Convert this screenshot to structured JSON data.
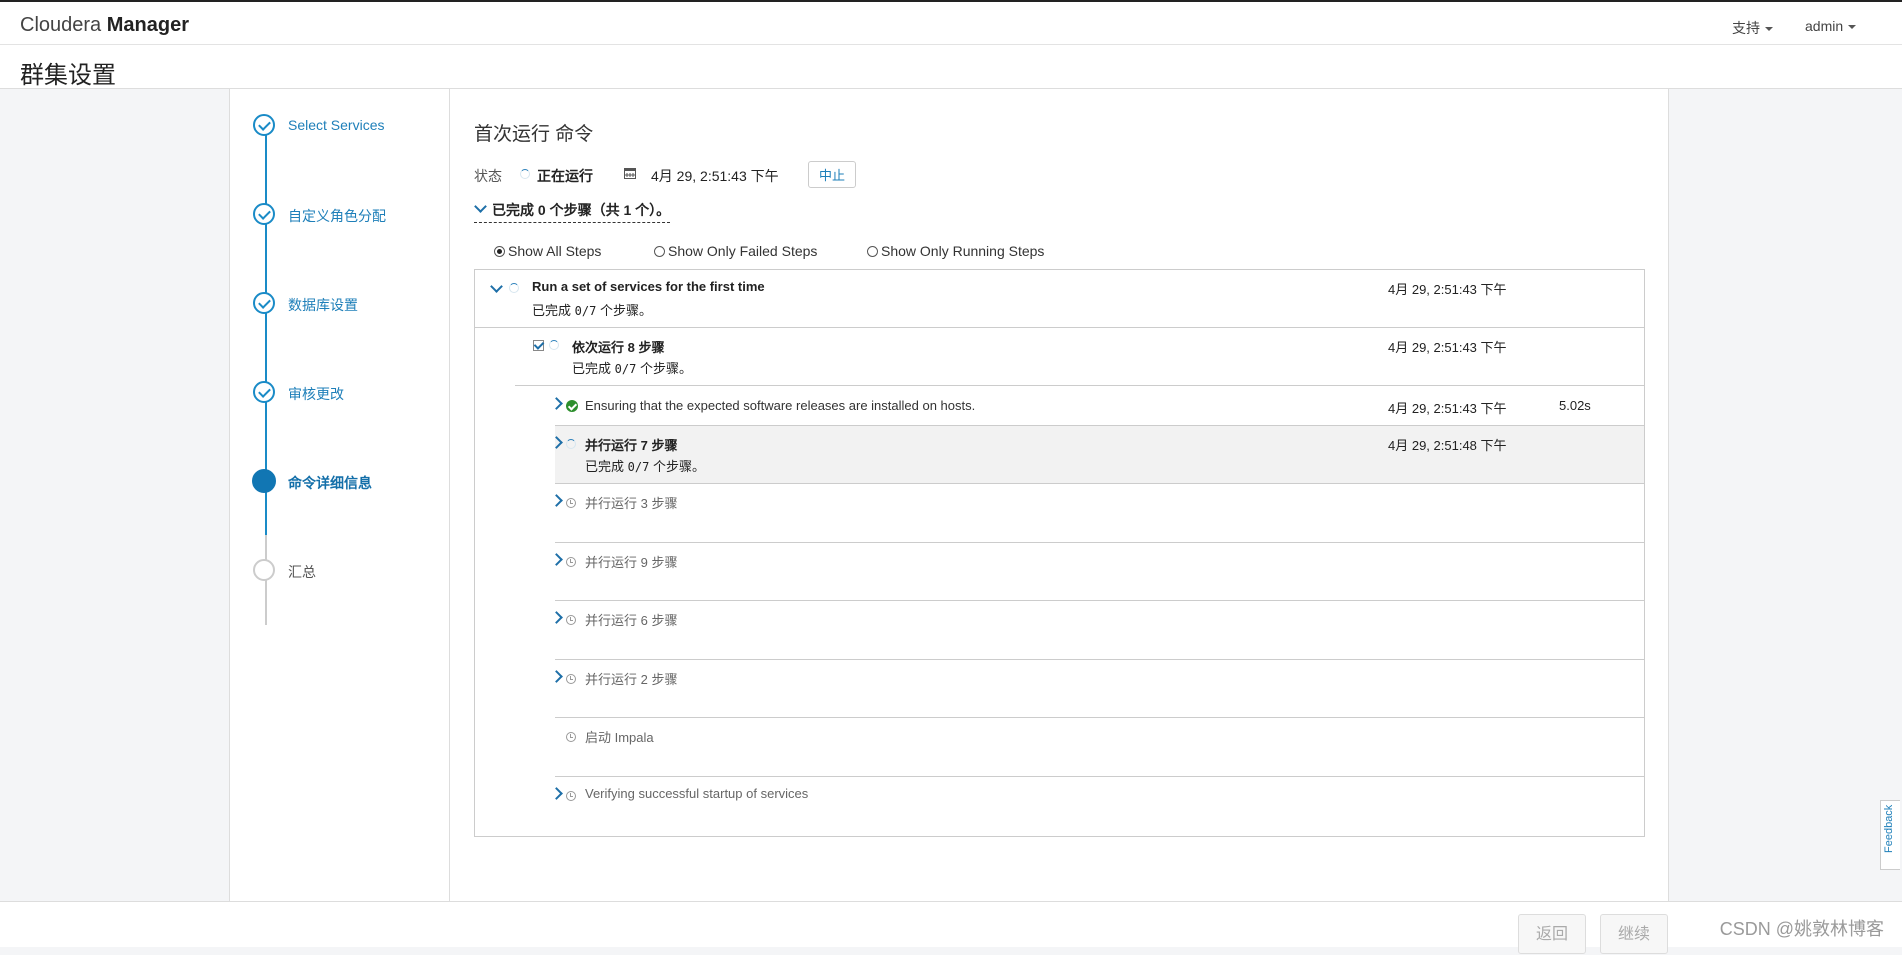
{
  "navbar": {
    "brand_light": "Cloudera",
    "brand_bold": "Manager",
    "support_label": "支持",
    "user_label": "admin"
  },
  "page_title": "群集设置",
  "wizard": {
    "steps": [
      {
        "label": "Select Services",
        "state": "done"
      },
      {
        "label": "自定义角色分配",
        "state": "done"
      },
      {
        "label": "数据库设置",
        "state": "done"
      },
      {
        "label": "审核更改",
        "state": "done"
      },
      {
        "label": "命令详细信息",
        "state": "active"
      },
      {
        "label": "汇总",
        "state": "pending"
      }
    ]
  },
  "command": {
    "title": "首次运行 命令",
    "status_label": "状态",
    "status_value": "正在运行",
    "status_time": "4月 29, 2:51:43 下午",
    "abort_label": "中止",
    "completed_summary": "已完成 0 个步骤（共 1 个）。"
  },
  "filters": [
    {
      "label": "Show All Steps",
      "selected": true
    },
    {
      "label": "Show Only Failed Steps",
      "selected": false
    },
    {
      "label": "Show Only Running Steps",
      "selected": false
    }
  ],
  "steps_table": {
    "root": {
      "title": "Run a set of services for the first time",
      "progress_prefix": "已完成",
      "progress": "0/7",
      "progress_suffix": "个步骤。",
      "time": "4月 29, 2:51:43 下午"
    },
    "sequence": {
      "title": "依次运行 8 步骤",
      "progress_prefix": "已完成",
      "progress": "0/7",
      "progress_suffix": "个步骤。",
      "time": "4月 29, 2:51:43 下午"
    },
    "children": [
      {
        "title": "Ensuring that the expected software releases are installed on hosts.",
        "time": "4月 29, 2:51:43 下午",
        "duration": "5.02s",
        "state": "success"
      },
      {
        "title": "并行运行 7 步骤",
        "time": "4月 29, 2:51:48 下午",
        "progress_prefix": "已完成",
        "progress": "0/7",
        "progress_suffix": "个步骤。",
        "state": "running"
      },
      {
        "title": "并行运行 3 步骤",
        "state": "pending"
      },
      {
        "title": "并行运行 9 步骤",
        "state": "pending"
      },
      {
        "title": "并行运行 6 步骤",
        "state": "pending"
      },
      {
        "title": "并行运行 2 步骤",
        "state": "pending"
      },
      {
        "title": "启动 Impala",
        "state": "pending"
      },
      {
        "title": "Verifying successful startup of services",
        "state": "pending"
      }
    ]
  },
  "footer": {
    "back_label": "返回",
    "continue_label": "继续"
  },
  "feedback_label": "Feedback",
  "watermark": "CSDN @姚敦林博客",
  "colors": {
    "link_blue": "#1e7fb9",
    "active_blue": "#1176b3",
    "success_green": "#2d8f2d"
  }
}
